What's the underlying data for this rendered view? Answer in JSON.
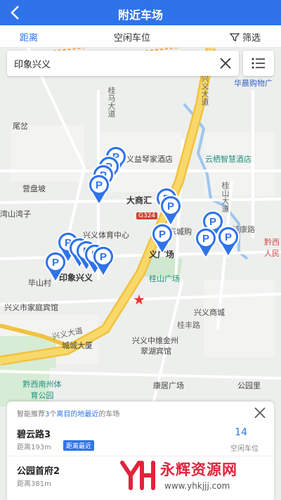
{
  "header": {
    "title": "附近车场"
  },
  "tabs": {
    "distance": "距离",
    "free_spaces": "空闲车位",
    "filter": "筛选"
  },
  "search": {
    "value": "印象兴义"
  },
  "map": {
    "labels": {
      "huaxin": "华晨购物广",
      "guima": "桂马大道",
      "xingyi_avenue_top": "兴义大道",
      "weiya": "尾岔",
      "yizhen": "义益琴家酒店",
      "yunqi": "云栖智慧酒店",
      "yingpo": "营盘坡",
      "dashang": "大商汇",
      "g324": "G324",
      "guishan": "桂山大道",
      "wanshan": "湾山湾子",
      "guikang": "桂康路",
      "sports": "兴义体育中心",
      "chengshou": "东城购",
      "yiguangchang": "义广场",
      "guishan_square": "桂山广场",
      "qianxi_hospital": "黔西人民",
      "bishan": "毕山村",
      "yinxiang": "印象兴义",
      "family_hotel": "兴义市家庭宾馆",
      "xingyi_mall": "兴义商城",
      "xingyi_avenue": "兴义大道",
      "guifeng": "桂丰路",
      "chengcheng": "城城大厦",
      "jinzhou": "兴义中维金州",
      "cuihu": "翠湖宾馆",
      "sports_park": "黔西南州体育公园",
      "kangju": "康居广场",
      "park": "公园里"
    }
  },
  "panel": {
    "rec_prefix": "智能推荐",
    "rec_count": "3",
    "rec_mid": "个",
    "rec_hl": "离目的地最近",
    "rec_suffix": "的车场",
    "items": [
      {
        "name": "碧云路3",
        "distance": "距离193m",
        "tag": "距离最近",
        "count": "14",
        "count_label": "空闲车位"
      },
      {
        "name": "公园首府2",
        "distance": "距离381m"
      }
    ]
  },
  "watermark": {
    "text": "永辉资源网",
    "url": "www.yhkjjj.com"
  }
}
